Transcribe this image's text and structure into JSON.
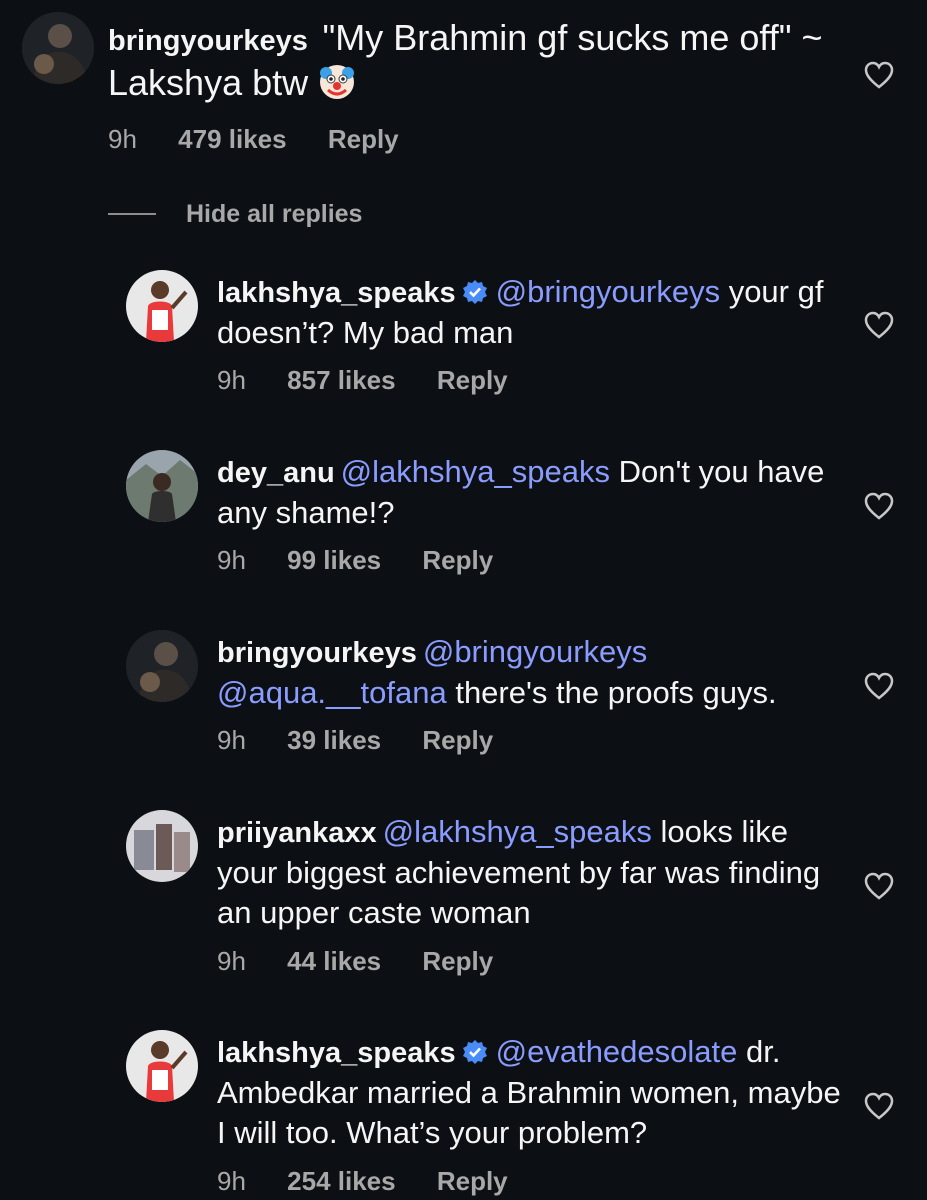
{
  "comments": [
    {
      "username": "bringyourkeys",
      "verified": false,
      "pre": "",
      "mention": "",
      "text": "\"My Brahmin gf sucks me off\" ~ Lakshya btw",
      "emoji": "clown-face-icon",
      "time": "9h",
      "likes": "479 likes",
      "reply": "Reply"
    },
    {
      "username": "lakhshya_speaks",
      "verified": true,
      "pre": "",
      "mention": "@bringyourkeys",
      "text": " your gf doesn’t? My bad man",
      "time": "9h",
      "likes": "857 likes",
      "reply": "Reply"
    },
    {
      "username": "dey_anu",
      "verified": false,
      "pre": "",
      "mention": "@lakhshya_speaks",
      "text": " Don't you have any shame!?",
      "time": "9h",
      "likes": "99 likes",
      "reply": "Reply"
    },
    {
      "username": "bringyourkeys",
      "verified": false,
      "pre": "@bringyourkeys ",
      "mention": "@aqua.__tofana",
      "text": " there's the proofs guys.",
      "time": "9h",
      "likes": "39 likes",
      "reply": "Reply"
    },
    {
      "username": "priiyankaxx",
      "verified": false,
      "pre": "",
      "mention": "@lakhshya_speaks",
      "text": " looks like your biggest achievement by far was finding an upper caste woman",
      "time": "9h",
      "likes": "44 likes",
      "reply": "Reply"
    },
    {
      "username": "lakhshya_speaks",
      "verified": true,
      "pre": "",
      "mention": "@evathedesolate",
      "text": " dr. Ambedkar married a Brahmin women, maybe I will too. What’s your problem?",
      "time": "9h",
      "likes": "254 likes",
      "reply": "Reply"
    }
  ],
  "hide_replies_label": "Hide all replies",
  "colors": {
    "background": "#0c1014",
    "text": "#f5f5f5",
    "muted": "#a8a8a8",
    "mention": "#8b9cff",
    "verified": "#4a8cf7"
  }
}
